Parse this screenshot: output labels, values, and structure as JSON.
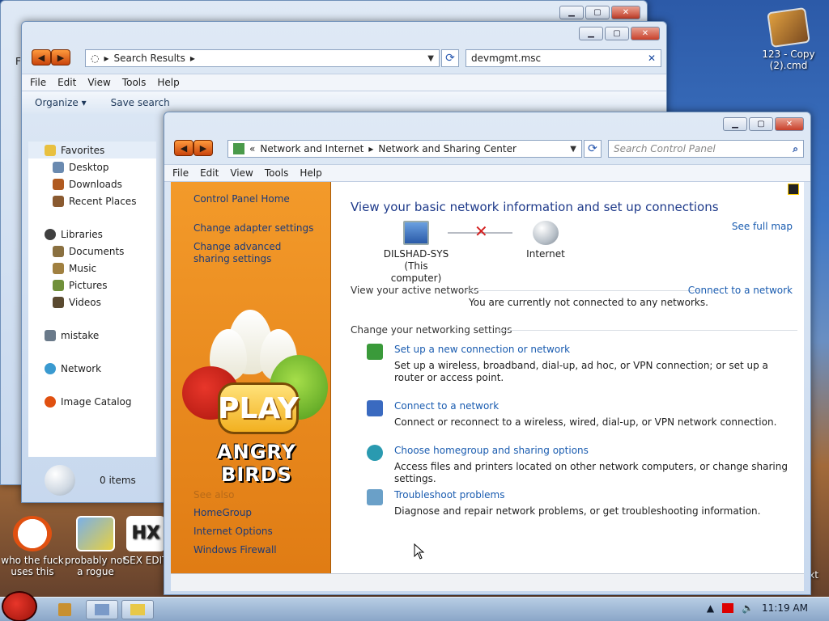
{
  "desktop": {
    "icons": [
      {
        "label": "123 - Copy (2).cmd"
      },
      {
        "label": "who the fuck uses this"
      },
      {
        "label": "probably not a rogue"
      },
      {
        "label": "SEX EDIT"
      },
      {
        "label": "xt"
      }
    ]
  },
  "explorer": {
    "address": "Search Results",
    "search_value": "devmgmt.msc",
    "menu": [
      "File",
      "Edit",
      "View",
      "Tools",
      "Help"
    ],
    "toolbar": {
      "organize": "Organize",
      "save_search": "Save search"
    },
    "favorites": {
      "label": "Favorites",
      "items": [
        "Desktop",
        "Downloads",
        "Recent Places"
      ]
    },
    "libraries": {
      "label": "Libraries",
      "items": [
        "Documents",
        "Music",
        "Pictures",
        "Videos"
      ]
    },
    "other": [
      "mistake",
      "Network",
      "Image Catalog"
    ],
    "status": "0 items",
    "back_menu_partial": "F"
  },
  "cpl": {
    "breadcrumb": [
      "Network and Internet",
      "Network and Sharing Center"
    ],
    "search_placeholder": "Search Control Panel",
    "menu": [
      "File",
      "Edit",
      "View",
      "Tools",
      "Help"
    ],
    "tasks": {
      "home": "Control Panel Home",
      "adapter": "Change adapter settings",
      "advanced": "Change advanced sharing settings",
      "see_also": "See also",
      "homegroup": "HomeGroup",
      "internet_options": "Internet Options",
      "firewall": "Windows Firewall"
    },
    "banner": {
      "play": "PLAY",
      "title": "ANGRY BIRDS"
    },
    "title": "View your basic network information and set up connections",
    "see_full_map": "See full map",
    "computer_name": "DILSHAD-SYS",
    "computer_sub": "(This computer)",
    "internet": "Internet",
    "active_networks_label": "View your active networks",
    "connect_link": "Connect to a network",
    "not_connected": "You are currently not connected to any networks.",
    "change_settings_label": "Change your networking settings",
    "settings": [
      {
        "title": "Set up a new connection or network",
        "desc": "Set up a wireless, broadband, dial-up, ad hoc, or VPN connection; or set up a router or access point.",
        "icon": "new-connection-icon"
      },
      {
        "title": "Connect to a network",
        "desc": "Connect or reconnect to a wireless, wired, dial-up, or VPN network connection.",
        "icon": "connect-network-icon"
      },
      {
        "title": "Choose homegroup and sharing options",
        "desc": "Access files and printers located on other network computers, or change sharing settings.",
        "icon": "homegroup-icon"
      },
      {
        "title": "Troubleshoot problems",
        "desc": "Diagnose and repair network problems, or get troubleshooting information.",
        "icon": "troubleshoot-icon"
      }
    ]
  },
  "taskbar": {
    "time": "11:19 AM"
  },
  "colors": {
    "link": "#1a5cb0",
    "orange_pane": "#f39a2a",
    "title_blue": "#1e3a8a"
  }
}
